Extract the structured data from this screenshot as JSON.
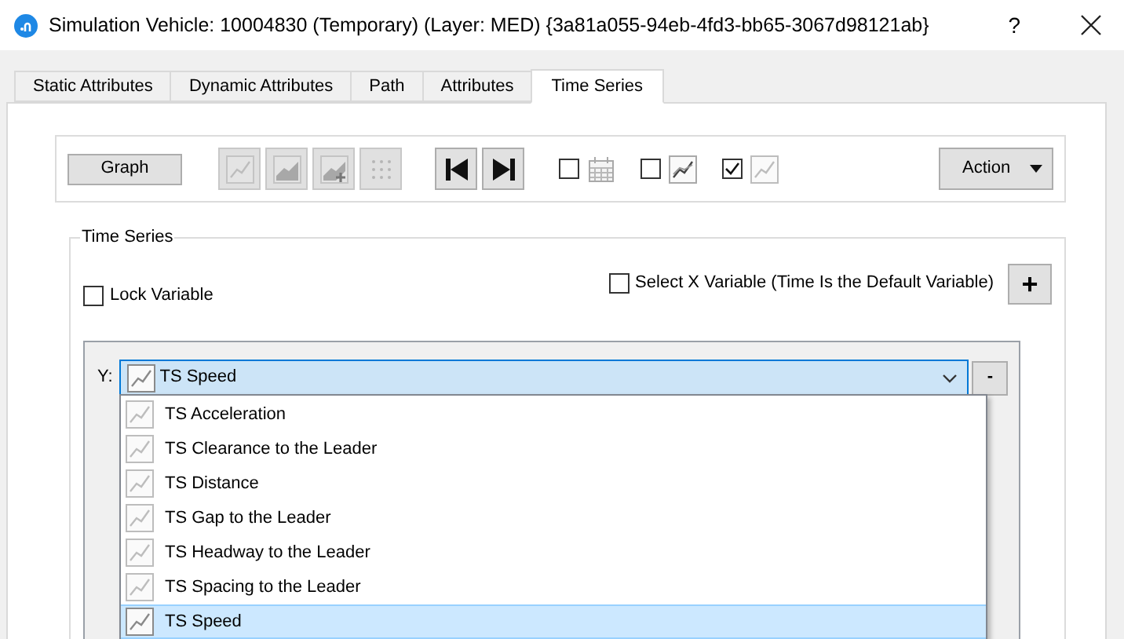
{
  "window": {
    "title": "Simulation Vehicle: 10004830 (Temporary) (Layer: MED) {3a81a055-94eb-4fd3-bb65-3067d98121ab}",
    "help": "?"
  },
  "tabs": [
    {
      "label": "Static Attributes",
      "selected": false
    },
    {
      "label": "Dynamic Attributes",
      "selected": false
    },
    {
      "label": "Path",
      "selected": false
    },
    {
      "label": "Attributes",
      "selected": false
    },
    {
      "label": "Time Series",
      "selected": true
    }
  ],
  "toolbar": {
    "graph_button": "Graph",
    "tool_buttons": [
      {
        "kind": "line",
        "disabled": true
      },
      {
        "kind": "area",
        "disabled": true
      },
      {
        "kind": "add",
        "disabled": true
      },
      {
        "kind": "grid",
        "disabled": true
      },
      {
        "kind": "first",
        "disabled": false
      },
      {
        "kind": "last",
        "disabled": false
      }
    ],
    "toggles": [
      {
        "kind": "calendar",
        "checked": false
      },
      {
        "kind": "trend",
        "checked": false
      },
      {
        "kind": "line",
        "checked": true
      }
    ],
    "action_button": "Action"
  },
  "time_series": {
    "title": "Time Series",
    "lock_variable": {
      "label": "Lock Variable",
      "checked": false
    },
    "select_x": {
      "label": "Select X Variable (Time Is the Default Variable)",
      "checked": false
    },
    "add_button": "+",
    "y_label": "Y:",
    "y_value": "TS Speed",
    "remove_button": "-",
    "options": [
      {
        "label": "TS Acceleration",
        "selected": false
      },
      {
        "label": "TS Clearance to the Leader",
        "selected": false
      },
      {
        "label": "TS Distance",
        "selected": false
      },
      {
        "label": "TS Gap to the Leader",
        "selected": false
      },
      {
        "label": "TS Headway to the Leader",
        "selected": false
      },
      {
        "label": "TS Spacing to the Leader",
        "selected": false
      },
      {
        "label": "TS Speed",
        "selected": true
      }
    ]
  }
}
